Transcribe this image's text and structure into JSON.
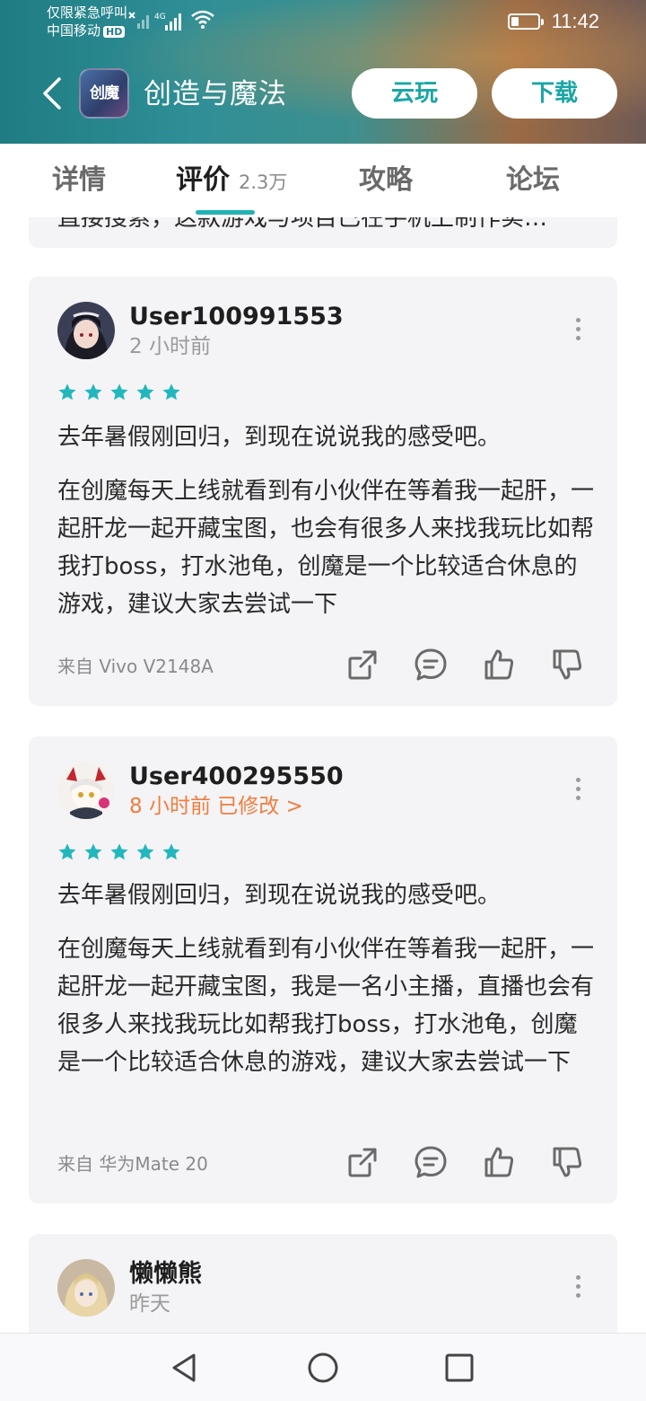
{
  "status_bar": {
    "carrier_line1": "仅限紧急呼叫",
    "carrier_line2": "中国移动",
    "hd_badge": "HD",
    "network": "4G",
    "time": "11:42"
  },
  "header": {
    "app_icon_text": "创魔",
    "title": "创造与魔法",
    "cloud_play_label": "云玩",
    "download_label": "下载"
  },
  "tabs": [
    {
      "label": "详情"
    },
    {
      "label": "评价",
      "count": "2.3万",
      "active": true
    },
    {
      "label": "攻略"
    },
    {
      "label": "论坛"
    }
  ],
  "previous_review_snippet": "直接搜索，这款游戏与项目已在手机上制作实…",
  "reviews": [
    {
      "user": "User100991553",
      "time": "2 小时前",
      "edited": "",
      "stars": 5,
      "paragraphs": [
        "去年暑假刚回归，到现在说说我的感受吧。",
        "在创魔每天上线就看到有小伙伴在等着我一起肝，一起肝龙一起开藏宝图，也会有很多人来找我玩比如帮我打boss，打水池龟，创魔是一个比较适合休息的游戏，建议大家去尝试一下"
      ],
      "device": "来自 Vivo V2148A"
    },
    {
      "user": "User400295550",
      "time": "8 小时前",
      "edited": "已修改 >",
      "stars": 5,
      "paragraphs": [
        "去年暑假刚回归，到现在说说我的感受吧。",
        "在创魔每天上线就看到有小伙伴在等着我一起肝，一起肝龙一起开藏宝图，我是一名小主播，直播也会有很多人来找我玩比如帮我打boss，打水池龟，创魔是一个比较适合休息的游戏，建议大家去尝试一下"
      ],
      "device": "来自 华为Mate 20"
    },
    {
      "user": "懒懒熊",
      "time": "昨天"
    }
  ],
  "colors": {
    "accent": "#21b2b4",
    "star": "#22b7bd",
    "edited": "#f27d3d",
    "card_bg": "#f4f4f7"
  }
}
